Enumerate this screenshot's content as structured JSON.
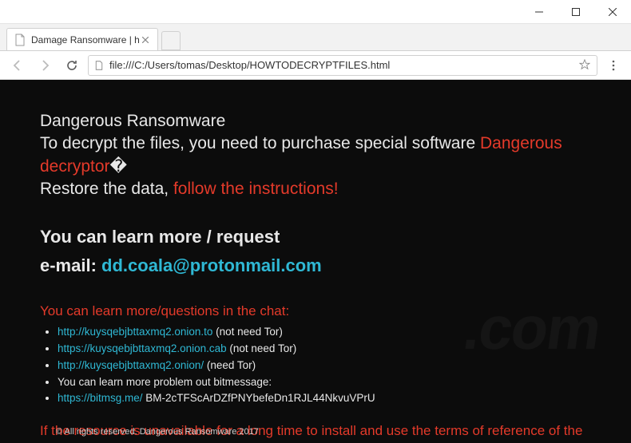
{
  "window": {
    "tab_title": "Damage Ransomware | h",
    "url": "file:///C:/Users/tomas/Desktop/HOWTODECRYPTFILES.html"
  },
  "content": {
    "heading_line1": "Dangerous Ransomware",
    "heading_line2a": "To decrypt the files, you need to purchase special software ",
    "heading_line2b": "Dangerous decryptor",
    "heading_diamond": "�",
    "heading_line3a": "Restore the data, ",
    "heading_line3b": "follow the instructions!",
    "learn_line1": "You can learn more / request",
    "learn_email_label": "e-mail: ",
    "learn_email": "dd.coala@protonmail.com",
    "chat_heading": "You can learn more/questions in the chat:",
    "links": [
      {
        "url": "http://kuysqebjbttaxmq2.onion.to",
        "note": " (not need Tor)"
      },
      {
        "url": "https://kuysqebjbttaxmq2.onion.cab",
        "note": " (not need Tor)"
      },
      {
        "url": "http://kuysqebjbttaxmq2.onion/",
        "note": " (need Tor)"
      }
    ],
    "bitmessage_label": "You can learn more problem out bitmessage:",
    "bitmsg_url": "https://bitmsg.me/",
    "bitmsg_addr": " BM-2cTFScArDZfPNYbefeDn1RJL44NkvuVPrU",
    "unavailable": "If the resource is unavailable for a long time to install and use the terms of reference of the",
    "copyright": "© All rights reserved. Dangerous Ransomware 2017"
  },
  "watermark": ".com"
}
